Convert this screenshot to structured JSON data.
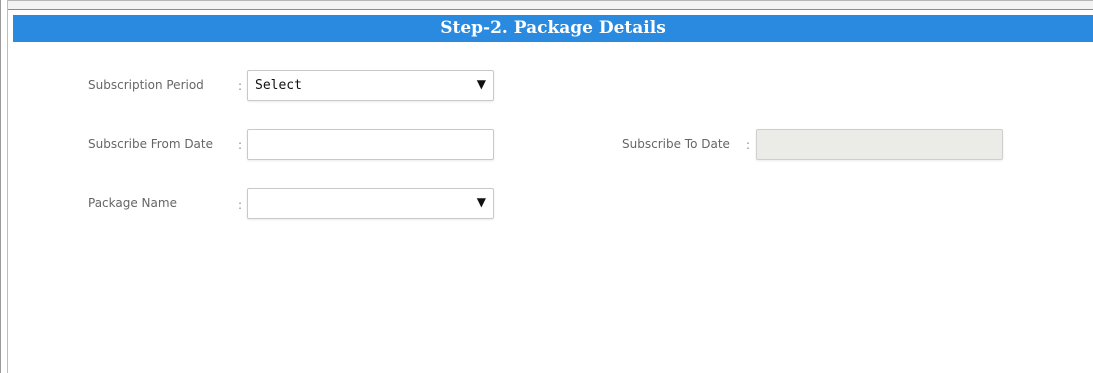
{
  "header": {
    "title": "Step-2. Package Details"
  },
  "form": {
    "colon": ":",
    "subscription_period": {
      "label": "Subscription Period",
      "selected": "Select",
      "arrow": "▼"
    },
    "subscribe_from_date": {
      "label": "Subscribe From Date",
      "value": ""
    },
    "subscribe_to_date": {
      "label": "Subscribe To Date",
      "value": "",
      "disabled": true
    },
    "package_name": {
      "label": "Package Name",
      "selected": "",
      "arrow": "▼"
    }
  },
  "colors": {
    "header_bg": "#2a8ae0",
    "header_text": "#ffffff",
    "label_text": "#666666",
    "disabled_bg": "#ebebe8"
  }
}
